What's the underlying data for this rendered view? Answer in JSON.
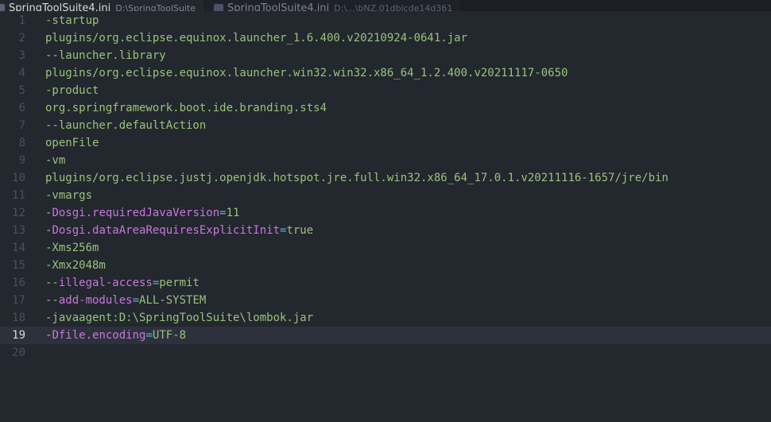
{
  "tabs": [
    {
      "label": "SpringToolSuite4.ini",
      "description": "D:\\SpringToolSuite",
      "close": "✕",
      "active": true
    },
    {
      "label": "SpringToolSuite4.ini",
      "description": "D:\\...\\bNZ.01dblcde14d361",
      "active": false
    }
  ],
  "lines": [
    {
      "n": "1",
      "opt": "-startup"
    },
    {
      "n": "2",
      "opt": "plugins/org.eclipse.equinox.launcher_1.6.400.v20210924-0641.jar"
    },
    {
      "n": "3",
      "opt": "--launcher.library"
    },
    {
      "n": "4",
      "opt": "plugins/org.eclipse.equinox.launcher.win32.win32.x86_64_1.2.400.v20211117-0650"
    },
    {
      "n": "5",
      "opt": "-product"
    },
    {
      "n": "6",
      "opt": "org.springframework.boot.ide.branding.sts4"
    },
    {
      "n": "7",
      "opt": "--launcher.defaultAction"
    },
    {
      "n": "8",
      "opt": "openFile"
    },
    {
      "n": "9",
      "opt": "-vm"
    },
    {
      "n": "10",
      "opt": "plugins/org.eclipse.justj.openjdk.hotspot.jre.full.win32.x86_64_17.0.1.v20211116-1657/jre/bin"
    },
    {
      "n": "11",
      "opt": "-vmargs"
    },
    {
      "n": "12",
      "opt": "-",
      "key": "Dosgi.requiredJavaVersion",
      "op": "=",
      "val": "11"
    },
    {
      "n": "13",
      "opt": "-",
      "key": "Dosgi.dataAreaRequiresExplicitInit",
      "op": "=",
      "val": "true"
    },
    {
      "n": "14",
      "opt": "-Xms256m"
    },
    {
      "n": "15",
      "opt": "-Xmx2048m"
    },
    {
      "n": "16",
      "opt": "--",
      "key": "illegal-access",
      "op": "=",
      "val": "permit"
    },
    {
      "n": "17",
      "opt": "--",
      "key": "add-modules",
      "op": "=",
      "val": "ALL-SYSTEM"
    },
    {
      "n": "18",
      "opt": "-javaagent:D:\\SpringToolSuite\\lombok.jar"
    },
    {
      "n": "19",
      "opt": "-",
      "key": "Dfile.encoding",
      "op": "=",
      "val": "UTF-8",
      "current": true
    },
    {
      "n": "20",
      "opt": ""
    }
  ]
}
